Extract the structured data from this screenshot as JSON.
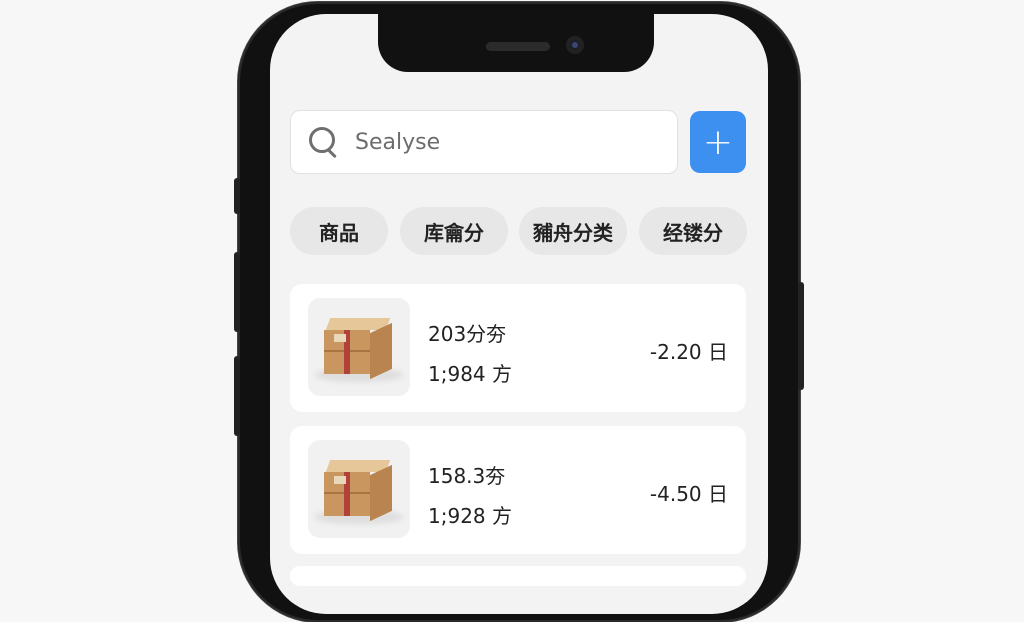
{
  "search": {
    "placeholder": "Sealyse",
    "icon": "search-icon"
  },
  "add_button": {
    "label": "+"
  },
  "filters": [
    "商品",
    "库龠分",
    "豧舟分类",
    "经镂分"
  ],
  "items": [
    {
      "line1": "203分夯",
      "line2": "1;984 方",
      "change": "-2.20 日"
    },
    {
      "line1": "158.3夯",
      "line2": "1;928 方",
      "change": "-4.50 日"
    }
  ],
  "colors": {
    "accent": "#3d8ff0",
    "background": "#f3f3f4",
    "chip": "#e7e7e7"
  }
}
